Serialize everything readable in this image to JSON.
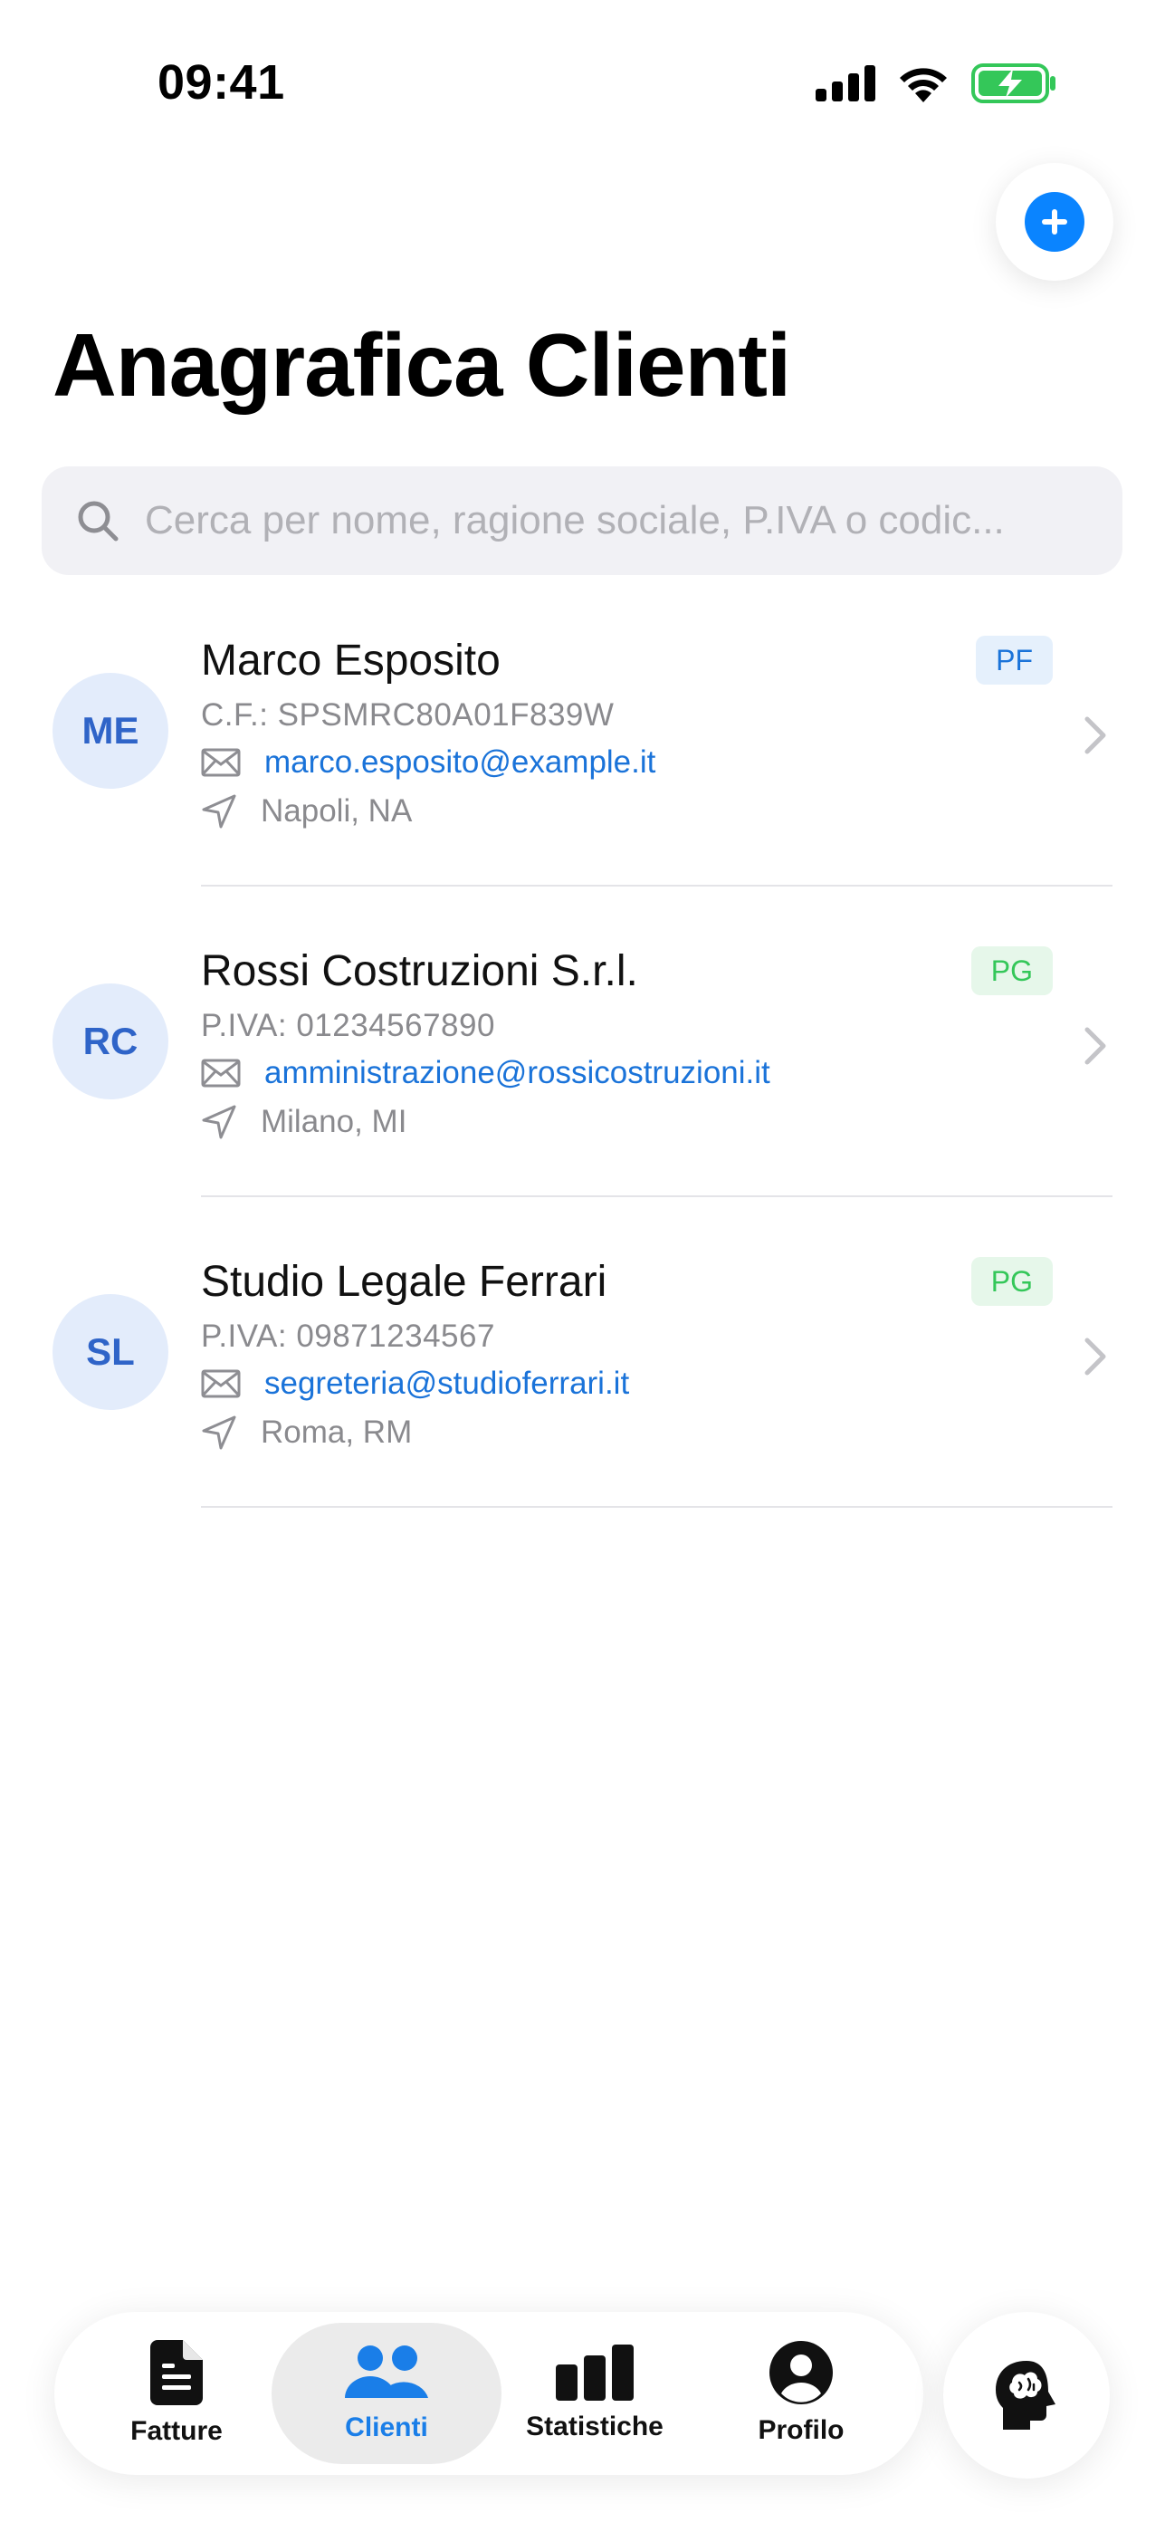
{
  "status_bar": {
    "time": "09:41",
    "battery_color": "#34c759"
  },
  "header": {
    "title": "Anagrafica Clienti",
    "add_icon": "plus-circle-icon",
    "accent_color": "#0a84ff"
  },
  "search": {
    "placeholder": "Cerca per nome, ragione sociale, P.IVA o codic...",
    "value": ""
  },
  "clients": [
    {
      "initials": "ME",
      "name": "Marco Esposito",
      "id_line": "C.F.: SPSMRC80A01F839W",
      "email": "marco.esposito@example.it",
      "city": "Napoli, NA",
      "badge": "PF"
    },
    {
      "initials": "RC",
      "name": "Rossi Costruzioni S.r.l.",
      "id_line": "P.IVA: 01234567890",
      "email": "amministrazione@rossicostruzioni.it",
      "city": "Milano, MI",
      "badge": "PG"
    },
    {
      "initials": "SL",
      "name": "Studio Legale Ferrari",
      "id_line": "P.IVA: 09871234567",
      "email": "segreteria@studioferrari.it",
      "city": "Roma, RM",
      "badge": "PG"
    }
  ],
  "tab_bar": {
    "tabs": [
      {
        "label": "Fatture",
        "icon": "document-icon",
        "active": false
      },
      {
        "label": "Clienti",
        "icon": "people-icon",
        "active": true
      },
      {
        "label": "Statistiche",
        "icon": "bar-chart-icon",
        "active": false
      },
      {
        "label": "Profilo",
        "icon": "person-icon",
        "active": false
      }
    ],
    "assistant_icon": "brain-head-icon"
  }
}
